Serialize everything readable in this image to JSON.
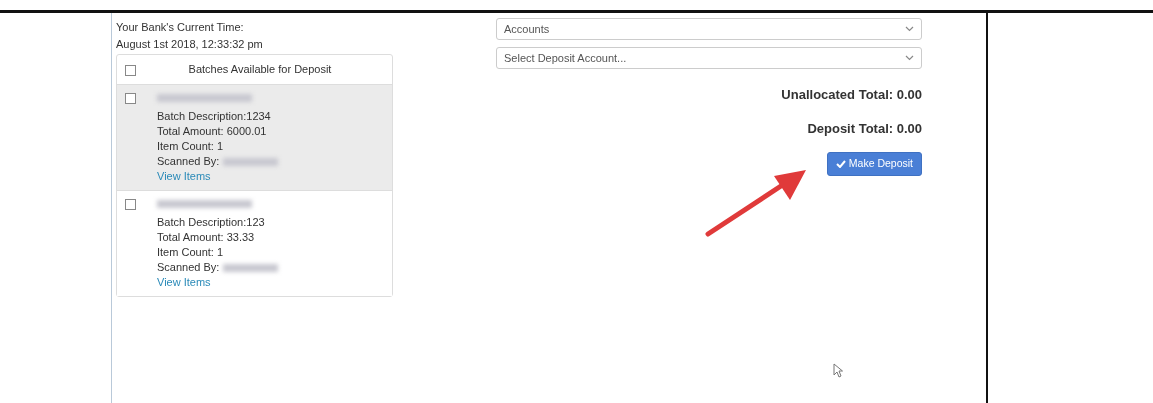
{
  "bank_time": {
    "label": "Your Bank's Current Time:",
    "value": "August 1st 2018, 12:33:32 pm"
  },
  "batches": {
    "header": "Batches Available for Deposit",
    "all_checked": false,
    "items": [
      {
        "checked": false,
        "highlighted": true,
        "description": "Batch Description:1234",
        "total": "Total Amount: 6000.01",
        "count": "Item Count: 1",
        "scanned_by": "Scanned By:",
        "link": "View Items"
      },
      {
        "checked": false,
        "highlighted": false,
        "description": "Batch Description:123",
        "total": "Total Amount: 33.33",
        "count": "Item Count: 1",
        "scanned_by": "Scanned By:",
        "link": "View Items"
      }
    ]
  },
  "selects": [
    {
      "value": "Accounts"
    },
    {
      "value": "Select Deposit Account..."
    }
  ],
  "totals": [
    "Unallocated Total: 0.00",
    "Deposit Total: 0.00"
  ],
  "button": {
    "label": "Make Deposit"
  }
}
